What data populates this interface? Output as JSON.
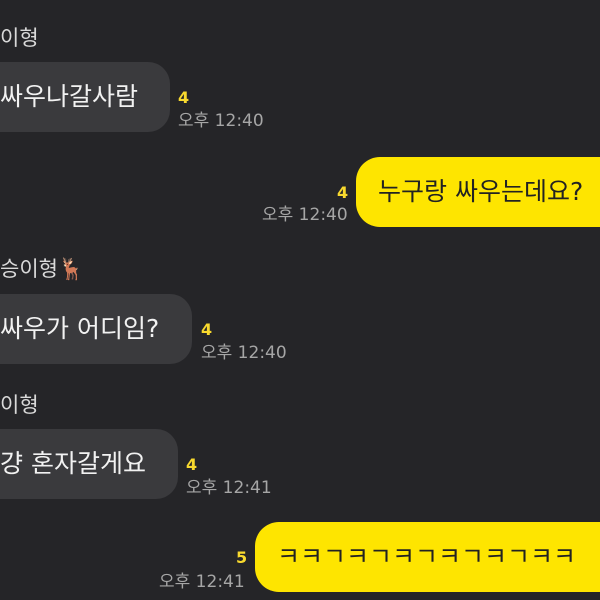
{
  "messages": [
    {
      "sender": "이형",
      "text": "싸우나갈사람",
      "unread": "4",
      "time": "오후 12:40"
    },
    {
      "text": "누구랑 싸우는데요?",
      "unread": "4",
      "time": "오후 12:40"
    },
    {
      "sender": "승이형🦌",
      "text": "싸우가 어디임?",
      "unread": "4",
      "time": "오후 12:40"
    },
    {
      "sender": "이형",
      "text": "걍 혼자갈게요",
      "unread": "4",
      "time": "오후 12:41"
    },
    {
      "text": "ㅋㅋㄱㅋㄱㅋㄱㅋㄱㅋㄱㅋㅋ",
      "unread": "5",
      "time": "오후 12:41"
    }
  ],
  "colors": {
    "background": "#252528",
    "incoming_bubble": "#3a3a3d",
    "outgoing_bubble": "#fee500",
    "unread_count": "#f8d92e"
  }
}
